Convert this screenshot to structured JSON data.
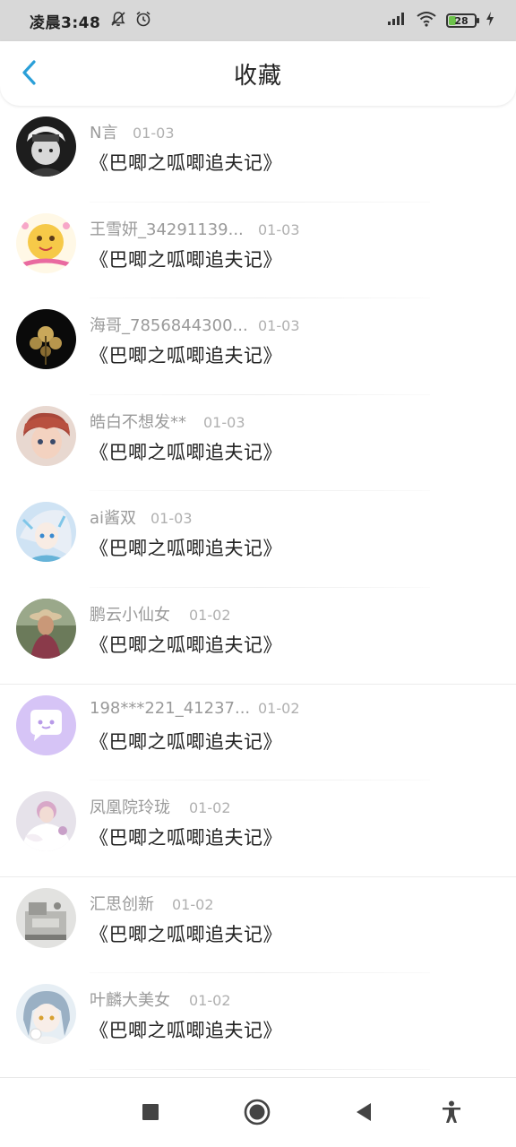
{
  "status_bar": {
    "time": "凌晨3:48",
    "battery": "28",
    "icons": [
      "mute-bell-icon",
      "alarm-icon",
      "signal-icon",
      "wifi-icon",
      "battery-icon",
      "charging-icon"
    ]
  },
  "header": {
    "title": "收藏",
    "back_icon": "chevron-left-icon",
    "accent_color": "#2a9fd8"
  },
  "items": [
    {
      "user": "N言",
      "date": "01-03",
      "title": "《巴唧之呱唧追夫记》"
    },
    {
      "user": "王雪妍_34291139...",
      "date": "01-03",
      "title": "《巴唧之呱唧追夫记》"
    },
    {
      "user": "海哥_7856844300...",
      "date": "01-03",
      "title": "《巴唧之呱唧追夫记》"
    },
    {
      "user": "皓白不想发**",
      "date": "01-03",
      "title": "《巴唧之呱唧追夫记》"
    },
    {
      "user": "ai酱双",
      "date": "01-03",
      "title": "《巴唧之呱唧追夫记》"
    },
    {
      "user": "鹏云小仙女",
      "date": "01-02",
      "title": "《巴唧之呱唧追夫记》"
    },
    {
      "user": "198***221_41237...",
      "date": "01-02",
      "title": "《巴唧之呱唧追夫记》"
    },
    {
      "user": "凤凰院玲珑",
      "date": "01-02",
      "title": "《巴唧之呱唧追夫记》"
    },
    {
      "user": "汇思创新",
      "date": "01-02",
      "title": "《巴唧之呱唧追夫记》"
    },
    {
      "user": "叶麟大美女",
      "date": "01-02",
      "title": "《巴唧之呱唧追夫记》"
    }
  ],
  "nav_bar": {
    "icons": [
      "recent-apps-icon",
      "home-icon",
      "back-icon",
      "accessibility-icon"
    ]
  }
}
